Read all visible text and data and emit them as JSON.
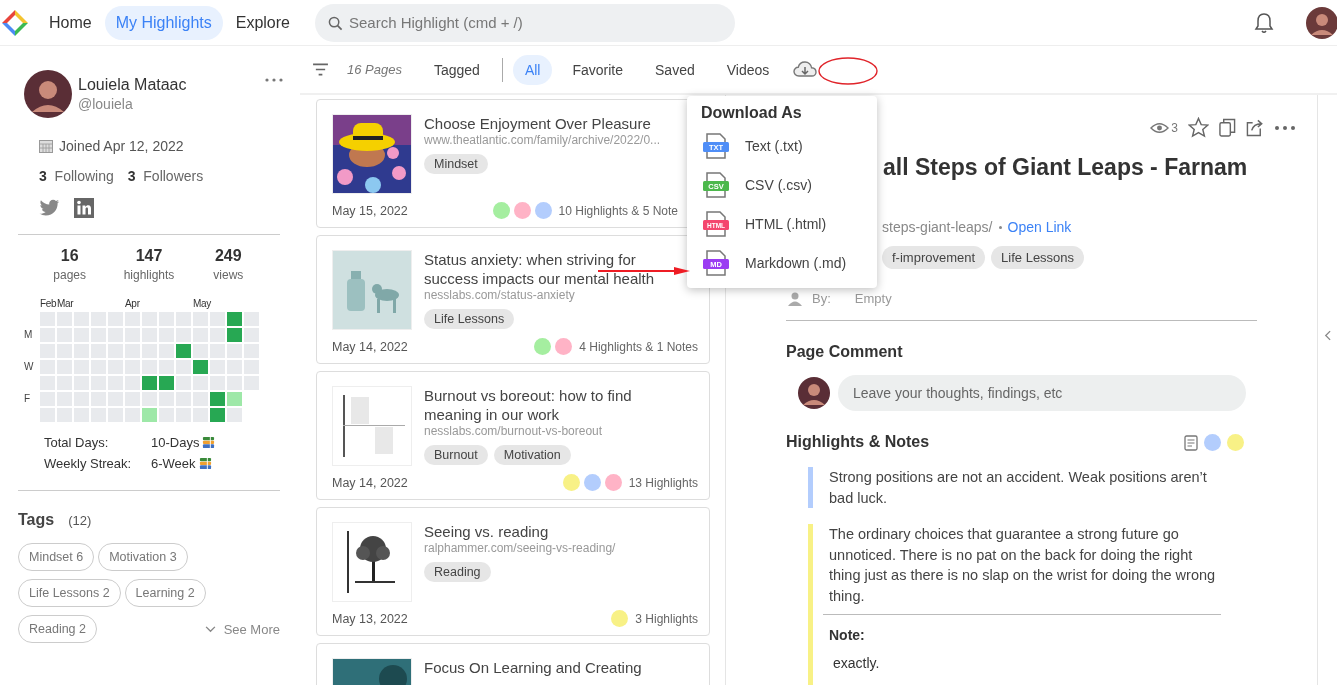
{
  "nav": {
    "items": [
      {
        "label": "Home",
        "selected": false
      },
      {
        "label": "My Highlights",
        "selected": true
      },
      {
        "label": "Explore",
        "selected": false
      }
    ],
    "search": {
      "placeholder": "Search Highlight (cmd + /)"
    }
  },
  "profile": {
    "name": "Louiela Mataac",
    "handle": "@louiela",
    "joined": "Joined Apr 12, 2022",
    "following_count": "3",
    "following_label": "Following",
    "followers_count": "3",
    "followers_label": "Followers"
  },
  "stats": [
    {
      "value": "16",
      "label": "pages"
    },
    {
      "value": "147",
      "label": "highlights"
    },
    {
      "value": "249",
      "label": "views"
    }
  ],
  "activity": {
    "day_labels": [
      "M",
      "W",
      "F"
    ],
    "weeks": [
      {
        "month": "Feb",
        "days": [
          {
            "color": "#e8eaed"
          },
          {
            "color": "#e8eaed"
          },
          {
            "color": "#e8eaed"
          },
          {
            "color": "#e8eaed"
          },
          {
            "color": "#e8eaed"
          },
          {
            "color": "#e8eaed"
          },
          {
            "color": "#e8eaed"
          }
        ]
      },
      {
        "month": "Mar",
        "days": [
          {
            "color": "#e8eaed"
          },
          {
            "color": "#e8eaed"
          },
          {
            "color": "#e8eaed"
          },
          {
            "color": "#e8eaed"
          },
          {
            "color": "#e8eaed"
          },
          {
            "color": "#e8eaed"
          },
          {
            "color": "#e8eaed"
          }
        ]
      },
      {
        "days": [
          {
            "color": "#e8eaed"
          },
          {
            "color": "#e8eaed"
          },
          {
            "color": "#e8eaed"
          },
          {
            "color": "#e8eaed"
          },
          {
            "color": "#e8eaed"
          },
          {
            "color": "#e8eaed"
          },
          {
            "color": "#e8eaed"
          }
        ]
      },
      {
        "days": [
          {
            "color": "#e8eaed"
          },
          {
            "color": "#e8eaed"
          },
          {
            "color": "#e8eaed"
          },
          {
            "color": "#e8eaed"
          },
          {
            "color": "#e8eaed"
          },
          {
            "color": "#e8eaed"
          },
          {
            "color": "#e8eaed"
          }
        ]
      },
      {
        "days": [
          {
            "color": "#e8eaed"
          },
          {
            "color": "#e8eaed"
          },
          {
            "color": "#e8eaed"
          },
          {
            "color": "#e8eaed"
          },
          {
            "color": "#e8eaed"
          },
          {
            "color": "#e8eaed"
          },
          {
            "color": "#e8eaed"
          }
        ]
      },
      {
        "month": "Apr",
        "days": [
          {
            "color": "#e8eaed"
          },
          {
            "color": "#e8eaed"
          },
          {
            "color": "#e8eaed"
          },
          {
            "color": "#e8eaed"
          },
          {
            "color": "#e8eaed"
          },
          {
            "color": "#e8eaed"
          },
          {
            "color": "#e8eaed"
          }
        ]
      },
      {
        "days": [
          {
            "color": "#e8eaed"
          },
          {
            "color": "#e8eaed"
          },
          {
            "color": "#e8eaed"
          },
          {
            "color": "#e8eaed"
          },
          {
            "color": "#27a853"
          },
          {
            "color": "#e8eaed"
          },
          {
            "color": "#9ee8a8"
          }
        ]
      },
      {
        "days": [
          {
            "color": "#e8eaed"
          },
          {
            "color": "#e8eaed"
          },
          {
            "color": "#e8eaed"
          },
          {
            "color": "#e8eaed"
          },
          {
            "color": "#27a853"
          },
          {
            "color": "#e8eaed"
          },
          {
            "color": "#e8eaed"
          }
        ]
      },
      {
        "days": [
          {
            "color": "#e8eaed"
          },
          {
            "color": "#e8eaed"
          },
          {
            "color": "#27a853"
          },
          {
            "color": "#e8eaed"
          },
          {
            "color": "#e8eaed"
          },
          {
            "color": "#e8eaed"
          },
          {
            "color": "#e8eaed"
          }
        ]
      },
      {
        "month": "May",
        "days": [
          {
            "color": "#e8eaed"
          },
          {
            "color": "#e8eaed"
          },
          {
            "color": "#e8eaed"
          },
          {
            "color": "#27a853"
          },
          {
            "color": "#e8eaed"
          },
          {
            "color": "#e8eaed"
          },
          {
            "color": "#e8eaed"
          }
        ]
      },
      {
        "days": [
          {
            "color": "#e8eaed"
          },
          {
            "color": "#e8eaed"
          },
          {
            "color": "#e8eaed"
          },
          {
            "color": "#e8eaed"
          },
          {
            "color": "#e8eaed"
          },
          {
            "color": "#27a853"
          },
          {
            "color": "#27a853"
          }
        ]
      },
      {
        "days": [
          {
            "color": "#27a853"
          },
          {
            "color": "#27a853"
          },
          {
            "color": "#e8eaed"
          },
          {
            "color": "#e8eaed"
          },
          {
            "color": "#e8eaed"
          },
          {
            "color": "#9ee8a8"
          },
          {
            "color": "#e8eaed"
          }
        ]
      },
      {
        "days": [
          {
            "color": "#e8eaed"
          },
          {
            "color": "#e8eaed"
          },
          {
            "color": "#e8eaed"
          },
          {
            "color": "#e8eaed"
          },
          {
            "color": "#e8eaed"
          }
        ]
      }
    ]
  },
  "summary": [
    {
      "label": "Total Days:",
      "value": "10-Days"
    },
    {
      "label": "Weekly Streak:",
      "value": "6-Week"
    }
  ],
  "tags": {
    "title": "Tags",
    "count": "(12)",
    "items": [
      "Mindset 6",
      "Motivation 3",
      "Life Lessons 2",
      "Learning 2",
      "Reading 2"
    ],
    "see_more": "See More"
  },
  "filter_bar": {
    "pages": "16 Pages",
    "tabs": [
      {
        "label": "Tagged",
        "selected": false
      },
      {
        "label": "All",
        "selected": true
      },
      {
        "label": "Favorite",
        "selected": false
      },
      {
        "label": "Saved",
        "selected": false
      },
      {
        "label": "Videos",
        "selected": false
      }
    ]
  },
  "cards": [
    {
      "title": "Choose Enjoyment Over Pleasure",
      "url": "www.theatlantic.com/family/archive/2022/0...",
      "tags": [
        "Mindset"
      ],
      "date": "May 15, 2022",
      "dots": [
        {
          "color": "#a5eea0"
        },
        {
          "color": "#ffb3c6"
        },
        {
          "color": "#b3cdfd"
        }
      ],
      "count": "10 Highlights & 5 Note"
    },
    {
      "title": "Status anxiety: when striving for success impacts our mental health",
      "url": "nesslabs.com/status-anxiety",
      "tags": [
        "Life Lessons"
      ],
      "date": "May 14, 2022",
      "dots": [
        {
          "color": "#a5eea0"
        },
        {
          "color": "#ffb3c6"
        }
      ],
      "count": "4 Highlights & 1 Notes"
    },
    {
      "title": "Burnout vs boreout: how to find meaning in our work",
      "url": "nesslabs.com/burnout-vs-boreout",
      "tags": [
        "Burnout",
        "Motivation"
      ],
      "date": "May 14, 2022",
      "dots": [
        {
          "color": "#f8f186"
        },
        {
          "color": "#b3cdfd"
        },
        {
          "color": "#ffb3c6"
        }
      ],
      "count": "13 Highlights"
    },
    {
      "title": "Seeing vs. reading",
      "url": "ralphammer.com/seeing-vs-reading/",
      "tags": [
        "Reading"
      ],
      "date": "May 13, 2022",
      "dots": [
        {
          "color": "#f8f186"
        }
      ],
      "count": "3 Highlights"
    },
    {
      "title": "Focus On Learning and Creating"
    }
  ],
  "download_menu": {
    "title": "Download As",
    "items": [
      {
        "badge": "TXT",
        "label": "Text (.txt)",
        "color": "#4f8ef7"
      },
      {
        "badge": "CSV",
        "label": "CSV (.csv)",
        "color": "#4cb84c"
      },
      {
        "badge": "HTML",
        "label": "HTML (.html)",
        "color": "#f4466e"
      },
      {
        "badge": "MD",
        "label": "Markdown (.md)",
        "color": "#9b3cf2"
      }
    ]
  },
  "detail": {
    "views": "3",
    "title": "all Steps of Giant Leaps - Farnam",
    "link": "steps-giant-leaps/",
    "open_link": "Open Link",
    "tags": [
      "f-improvement",
      "Life Lessons"
    ],
    "by_label": "By:",
    "by_value": "Empty",
    "comment": {
      "title": "Page Comment",
      "placeholder": "Leave your thoughts, findings, etc"
    },
    "highlights": {
      "title": "Highlights & Notes",
      "filters": [
        {
          "color": "#b3cdfd"
        },
        {
          "color": "#f8f186"
        }
      ],
      "items": [
        {
          "text": "Strong positions are not an accident. Weak positions aren’t bad luck.",
          "color": "#b3cdfd"
        },
        {
          "text": "The ordinary choices that guarantee a strong future go unnoticed. There is no pat on the back for doing the right thing just as there is no slap on the wrist for doing the wrong thing.",
          "color": "#f8f186",
          "note_label": "Note:",
          "note": "exactly."
        }
      ]
    }
  }
}
